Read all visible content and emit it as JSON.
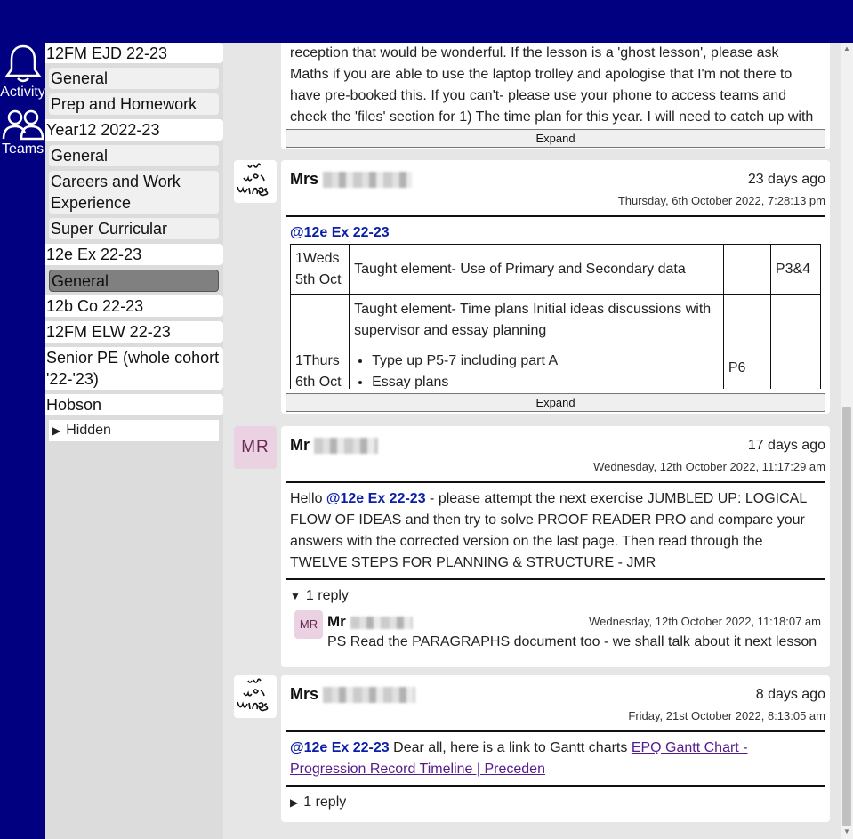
{
  "rail": {
    "activity_label": "Activity",
    "teams_label": "Teams"
  },
  "sidebar": {
    "teams": [
      {
        "name": "12FM EJD 22-23",
        "channels": [
          "General",
          "Prep and Homework"
        ]
      },
      {
        "name": "Year12 2022-23",
        "channels": [
          "General",
          "Careers and Work Experience",
          "Super Curricular"
        ]
      },
      {
        "name": "12e Ex 22-23",
        "channels": [
          "General"
        ],
        "active_channel": "General"
      },
      {
        "name": "12b Co 22-23",
        "channels": []
      },
      {
        "name": "12FM ELW 22-23",
        "channels": []
      },
      {
        "name": "Senior PE (whole cohort '22-'23)",
        "channels": []
      },
      {
        "name": "Hobson",
        "channels": []
      }
    ],
    "careers_line1": "Careers and Work",
    "careers_line2": "Experience",
    "senior_line1": "Senior PE (whole cohort",
    "senior_line2": "'22-'23)",
    "hidden_label": "Hidden"
  },
  "posts": {
    "p0": {
      "lines": [
        "reception that would be wonderful.  If the lesson is a 'ghost lesson', please ask",
        "Maths if you are able to use the laptop trolley and apologise that I'm not there to",
        "have pre-booked this.  If you can't- please use your phone to access teams and",
        "check the 'files' section for 1) The time plan for this year. I will need to catch up with"
      ],
      "expand_label": "Expand"
    },
    "p1": {
      "author": "Mrs",
      "ago": "23 days ago",
      "timestamp": "Thursday, 6th October 2022, 7:28:13 pm",
      "mention": "@12e Ex 22-23",
      "table": {
        "r1": {
          "c1a": "1Weds",
          "c1b": "5th Oct",
          "c2": "Taught element- Use of Primary and Secondary data",
          "c3": "",
          "c4": "P3&4"
        },
        "r2": {
          "c1a": "1Thurs",
          "c1b": "6th Oct",
          "c2": "Taught element- Time plans Initial ideas discussions with supervisor and essay planning",
          "bullet1": "Type up P5-7 including part A",
          "bullet2": "Essay plans",
          "c3": "P6",
          "c4": ""
        }
      },
      "expand_label": "Expand"
    },
    "p2": {
      "avatar": "MR",
      "author": "Mr",
      "ago": "17 days ago",
      "timestamp": "Wednesday, 12th October 2022, 11:17:29 am",
      "mention": "@12e Ex 22-23",
      "line1_pre": "Hello ",
      "line1_post": " - please attempt the next exercise JUMBLED UP: LOGICAL",
      "line2": "FLOW OF IDEAS and then try to solve PROOF READER PRO and compare your",
      "line3": "answers with the corrected version on the last page. Then read through the",
      "line4": "TWELVE STEPS FOR PLANNING & STRUCTURE - JMR",
      "reply_toggle": "1 reply",
      "reply": {
        "avatar": "MR",
        "author": "Mr",
        "timestamp": "Wednesday, 12th October 2022, 11:18:07 am",
        "text": "PS Read the PARAGRAPHS document too - we shall talk about it next lesson"
      }
    },
    "p3": {
      "author": "Mrs",
      "ago": "8 days ago",
      "timestamp": "Friday, 21st October 2022, 8:13:05 am",
      "mention": "@12e Ex 22-23",
      "text": " Dear all, here is a link to Gantt charts ",
      "link_line1": "EPQ Gantt Chart -",
      "link_line2": "Progression Record Timeline | Preceden",
      "reply_toggle": "1 reply"
    }
  },
  "colors": {
    "brand": "#000080",
    "mention": "#0b1fa6",
    "link": "#551a8b",
    "active_channel": "#808080"
  }
}
